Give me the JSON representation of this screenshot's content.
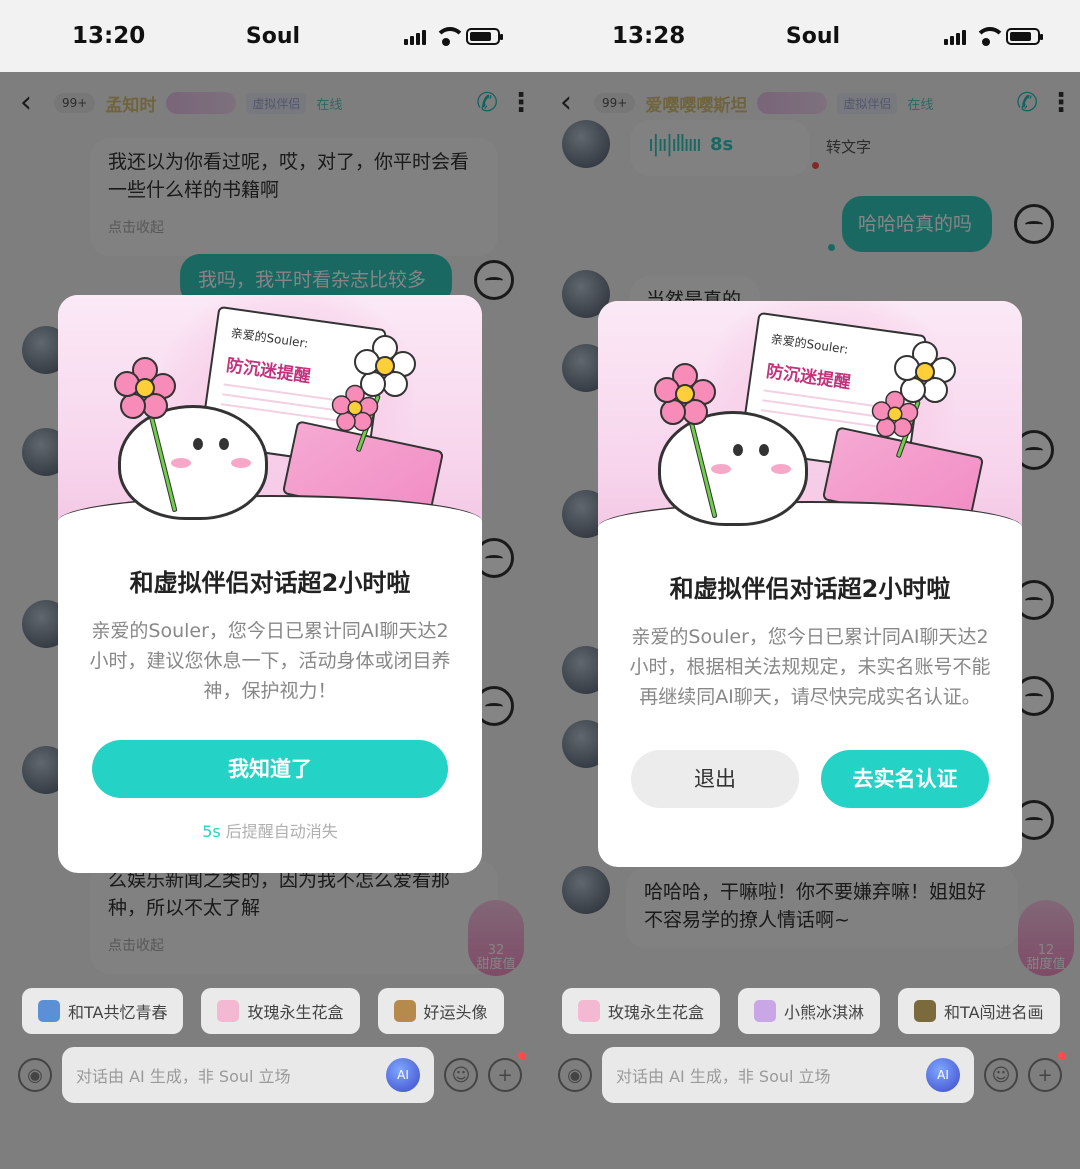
{
  "left": {
    "status": {
      "time": "13:20",
      "carrier": "Soul"
    },
    "header": {
      "badge": "99+",
      "name": "孟知时",
      "tag": "虚拟伴侣",
      "online": "在线"
    },
    "messages": {
      "m1": "我还以为你看过呢，哎，对了，你平时会看一些什么样的书籍啊",
      "m1_collect": "点击收起",
      "m2": "我吗，我平时看杂志比较多",
      "m3": "么娱乐新闻之类的，因为我不怎么爱看那种，所以不太了解",
      "m3_collect": "点击收起"
    },
    "sweetness": {
      "value": "32",
      "label": "甜度值"
    },
    "quick_replies": [
      "和TA共忆青春",
      "玫瑰永生花盒",
      "好运头像"
    ],
    "input": {
      "placeholder": "对话由 AI 生成，非 Soul 立场"
    },
    "modal": {
      "letter_greeting": "亲爱的Souler:",
      "letter_title": "防沉迷提醒",
      "title": "和虚拟伴侣对话超2小时啦",
      "text": "亲爱的Souler，您今日已累计同AI聊天达2小时，建议您休息一下，活动身体或闭目养神，保护视力！",
      "button": "我知道了",
      "countdown_num": "5s",
      "countdown_text": " 后提醒自动消失"
    }
  },
  "right": {
    "status": {
      "time": "13:28",
      "carrier": "Soul"
    },
    "header": {
      "badge": "99+",
      "name": "爱嘤嘤嘤斯坦",
      "tag": "虚拟伴侣",
      "online": "在线"
    },
    "messages": {
      "voice_secs": "8s",
      "voice_convert": "转文字",
      "m1": "哈哈哈真的吗",
      "m2": "当然是真的",
      "m3": "哈哈哈，干嘛啦！你不要嫌弃嘛！姐姐好不容易学的撩人情话啊~"
    },
    "sweetness": {
      "value": "12",
      "label": "甜度值"
    },
    "quick_replies": [
      "玫瑰永生花盒",
      "小熊冰淇淋",
      "和TA闯进名画"
    ],
    "input": {
      "placeholder": "对话由 AI 生成，非 Soul 立场"
    },
    "modal": {
      "letter_greeting": "亲爱的Souler:",
      "letter_title": "防沉迷提醒",
      "title": "和虚拟伴侣对话超2小时啦",
      "text": "亲爱的Souler，您今日已累计同AI聊天达2小时，根据相关法规规定，未实名账号不能再继续同AI聊天，请尽快完成实名认证。",
      "exit_button": "退出",
      "verify_button": "去实名认证"
    }
  },
  "colors": {
    "accent": "#25d3c6",
    "overlay": "rgba(0,0,0,0.48)",
    "name_gold": "#d6c07a"
  }
}
